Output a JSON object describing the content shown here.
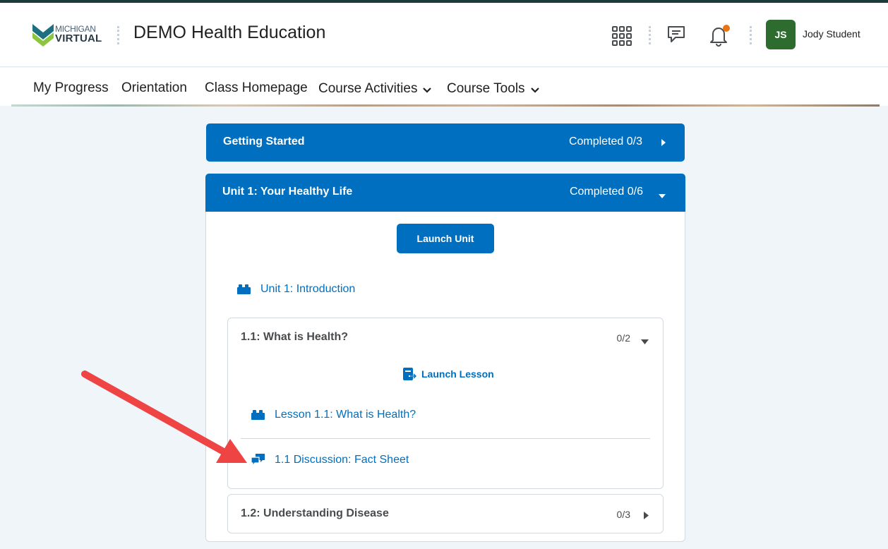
{
  "header": {
    "logo_line1": "MICHIGAN",
    "logo_line2": "VIRTUAL",
    "course_title": "DEMO Health Education",
    "icons": [
      "apps-grid-icon",
      "messages-icon",
      "bell-icon"
    ],
    "user_initials": "JS",
    "user_name": "Jody Student",
    "colors": {
      "avatar": "#2d6b2f",
      "notification_dot": "#e87511"
    }
  },
  "nav": {
    "items": [
      {
        "label": "My Progress"
      },
      {
        "label": "Orientation"
      },
      {
        "label": "Class Homepage"
      },
      {
        "label": "Course Activities"
      },
      {
        "label": "Course Tools"
      }
    ]
  },
  "modules": {
    "getting_started": {
      "title": "Getting Started",
      "status": "Completed 0/3"
    },
    "unit1": {
      "title": "Unit 1: Your Healthy Life",
      "status": "Completed 0/6",
      "launch_label": "Launch Unit",
      "intro_link": "Unit 1: Introduction",
      "lessons": [
        {
          "title": "1.1: What is Health?",
          "count": "0/2",
          "launch_label": "Launch Lesson",
          "items": [
            "Lesson 1.1: What is Health?",
            "1.1 Discussion: Fact Sheet"
          ]
        },
        {
          "title": "1.2: Understanding Disease",
          "count": "0/3"
        }
      ]
    }
  },
  "colors": {
    "primary": "#006fbf",
    "annotation_arrow": "#ef4444"
  }
}
